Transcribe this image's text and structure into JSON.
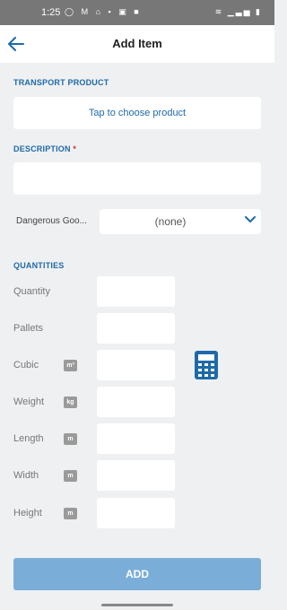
{
  "status_bar": {
    "time": "1:25",
    "left_icons": "◯ M ⌂ ▪ ▣ ■",
    "right_icons": "≋ ▁▃▅ ▮"
  },
  "header": {
    "title": "Add Item",
    "back_icon": "arrow-left-icon"
  },
  "transport_product": {
    "label": "TRANSPORT PRODUCT",
    "button_text": "Tap to choose product"
  },
  "description": {
    "label": "DESCRIPTION",
    "required_mark": "*",
    "value": ""
  },
  "dangerous_goods": {
    "label": "Dangerous Goo...",
    "value": "(none)"
  },
  "quantities": {
    "label": "QUANTITIES",
    "rows": [
      {
        "label": "Quantity",
        "unit": ""
      },
      {
        "label": "Pallets",
        "unit": ""
      },
      {
        "label": "Cubic",
        "unit": "m³"
      },
      {
        "label": "Weight",
        "unit": "kg"
      },
      {
        "label": "Length",
        "unit": "m"
      },
      {
        "label": "Width",
        "unit": "m"
      },
      {
        "label": "Height",
        "unit": "m"
      }
    ]
  },
  "add_button": "ADD",
  "colors": {
    "accent": "#1e6aa8",
    "background": "#eff0f2",
    "add_button": "#7aaed8",
    "required": "#d0302b"
  }
}
